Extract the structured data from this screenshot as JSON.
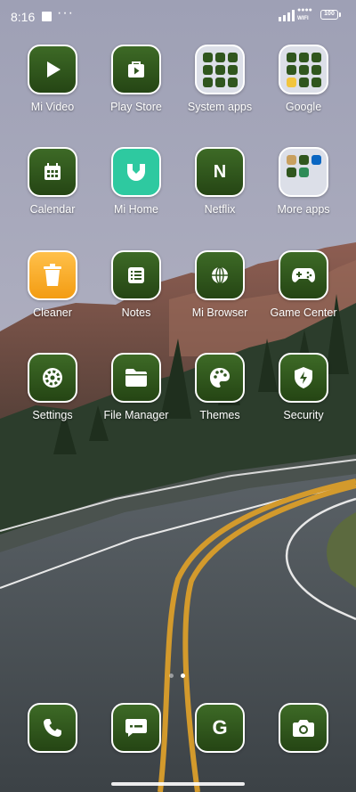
{
  "status_bar": {
    "time": "8:16",
    "notification_dots": "···",
    "wifi_text": "WIFI",
    "battery": "100"
  },
  "apps": [
    {
      "label": "Mi Video",
      "icon": "play-icon"
    },
    {
      "label": "Play Store",
      "icon": "play-store-icon"
    },
    {
      "label": "System apps",
      "icon": "folder-icon"
    },
    {
      "label": "Google",
      "icon": "folder-icon"
    },
    {
      "label": "Calendar",
      "icon": "calendar-icon"
    },
    {
      "label": "Mi Home",
      "icon": "mi-home-icon"
    },
    {
      "label": "Netflix",
      "icon": "netflix-icon",
      "glyph": "N"
    },
    {
      "label": "More apps",
      "icon": "folder-icon"
    },
    {
      "label": "Cleaner",
      "icon": "trash-icon"
    },
    {
      "label": "Notes",
      "icon": "notes-icon"
    },
    {
      "label": "Mi Browser",
      "icon": "globe-icon"
    },
    {
      "label": "Game Center",
      "icon": "gamepad-icon"
    },
    {
      "label": "Settings",
      "icon": "gear-icon"
    },
    {
      "label": "File Manager",
      "icon": "file-manager-icon"
    },
    {
      "label": "Themes",
      "icon": "palette-icon"
    },
    {
      "label": "Security",
      "icon": "shield-icon"
    }
  ],
  "dock": [
    {
      "icon": "phone-icon"
    },
    {
      "icon": "message-icon"
    },
    {
      "icon": "google-icon",
      "glyph": "G"
    },
    {
      "icon": "camera-icon"
    }
  ],
  "colors": {
    "icon_green": "#30561e",
    "mi_home_mint": "#2ec9a0",
    "cleaner_amber": "#f6a821"
  }
}
